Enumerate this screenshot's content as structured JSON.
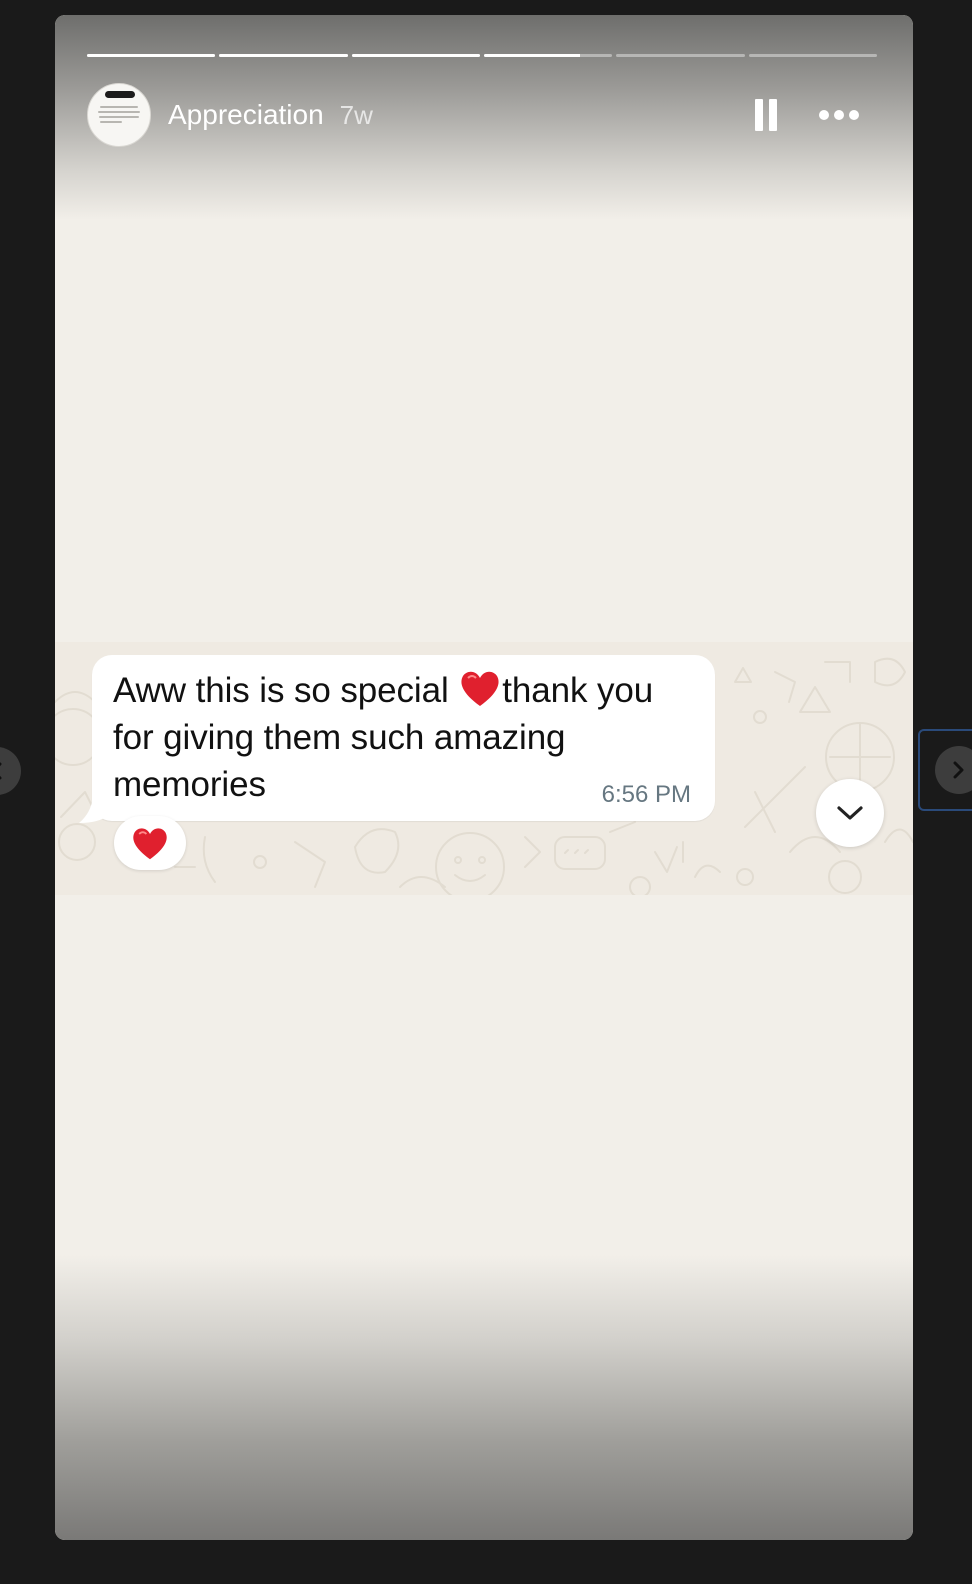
{
  "story": {
    "progress_segments": [
      1,
      1,
      1,
      0.75,
      0,
      0
    ],
    "account_name": "Appreciation",
    "posted_ago": "7w"
  },
  "message": {
    "text_before_emoji": "Aww this is so special ",
    "text_after_emoji": "thank you for giving them such amazing memories",
    "time": "6:56 PM",
    "reaction": "red-heart"
  },
  "icons": {
    "pause": "pause-icon",
    "more": "more-options-icon",
    "scroll_down": "chevron-down-icon",
    "prev": "chevron-left-icon",
    "next": "chevron-right-icon"
  },
  "colors": {
    "story_background": "#f2efe9",
    "chat_wallpaper": "#efeae2",
    "bubble": "#ffffff",
    "timestamp": "#667781",
    "heart": "#e0202e"
  }
}
